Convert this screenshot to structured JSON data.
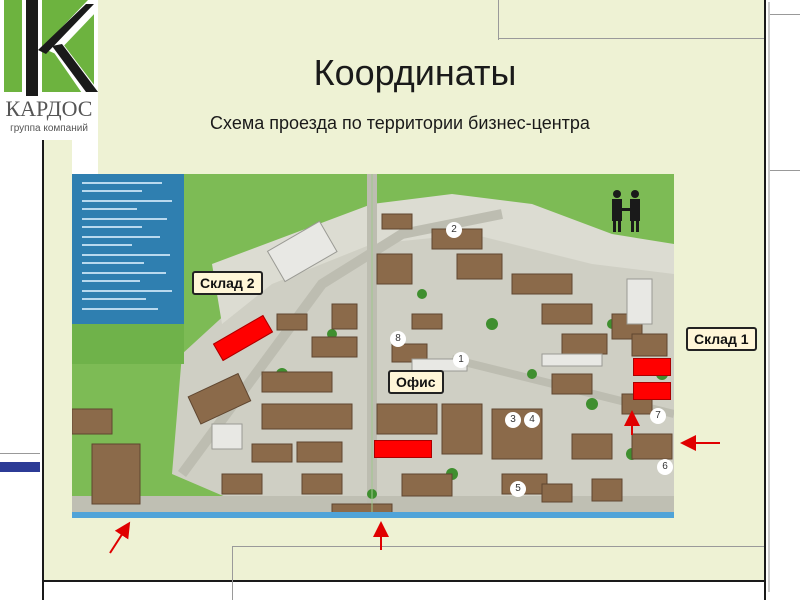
{
  "brand": {
    "name": "КАРДОС",
    "subtitle": "группа компаний"
  },
  "slide": {
    "title": "Координаты",
    "subtitle": "Схема проезда по территории бизнес-центра"
  },
  "map": {
    "labels": {
      "warehouse2": "Склад 2",
      "warehouse1": "Склад 1",
      "office": "Офис"
    },
    "building_numbers": [
      "1",
      "2",
      "3",
      "4",
      "5",
      "6",
      "7",
      "8"
    ]
  },
  "colors": {
    "panel": "#eef2d4",
    "map_grass": "#7dbb55",
    "legend": "#2f7fb0",
    "marker": "#ff0000",
    "arrow": "#e00000"
  }
}
